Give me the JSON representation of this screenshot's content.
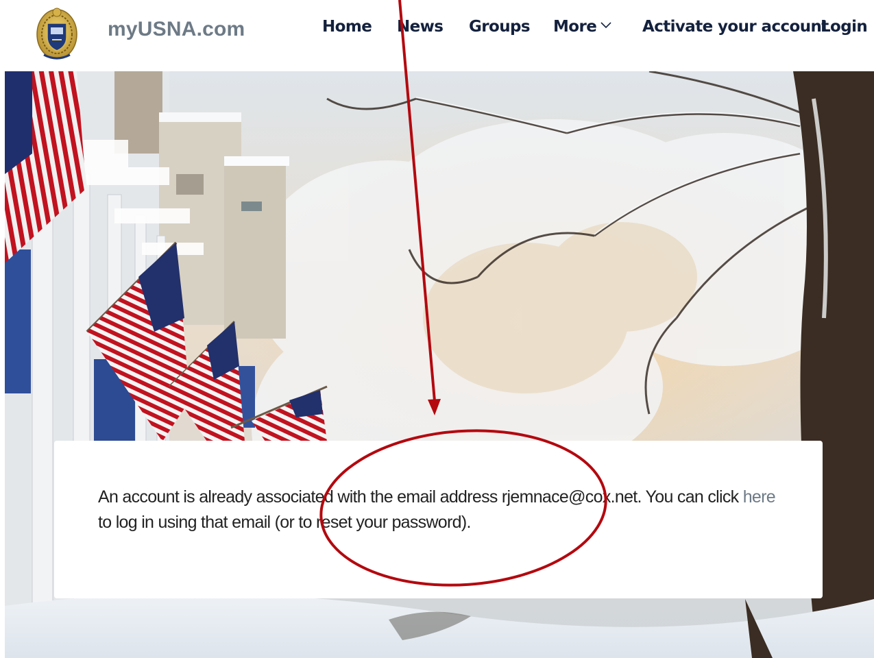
{
  "header": {
    "site_name": "myUSNA.com",
    "nav": {
      "home": "Home",
      "news": "News",
      "groups": "Groups",
      "more": "More",
      "activate": "Activate your account",
      "login": "Login"
    }
  },
  "message": {
    "part1": "An account is already associated with the email address rjemnace@cox.net. You can click ",
    "link_text": "here",
    "part2": " to log in using that email (or to reset your password)."
  },
  "colors": {
    "nav_text": "#14213d",
    "site_name": "#6d7a86",
    "link": "#6d7a86",
    "annotation": "#b3090f"
  },
  "icons": {
    "crest": "usna-crest-icon",
    "more": "chevron-down-icon"
  }
}
